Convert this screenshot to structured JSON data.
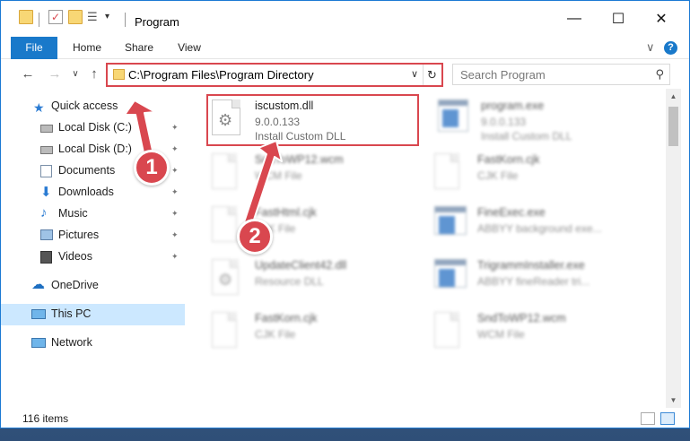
{
  "window": {
    "title": "Program",
    "minimize_label": "—",
    "maximize_label": "☐",
    "close_label": "✕",
    "accent_color": "#1979ca"
  },
  "ribbon": {
    "tabs": [
      "File",
      "Home",
      "Share",
      "View"
    ],
    "expand_glyph": "∨",
    "help_glyph": "?"
  },
  "navigation": {
    "back_glyph": "←",
    "forward_glyph": "→",
    "recent_glyph": "∨",
    "up_glyph": "↑",
    "address_path": "C:\\Program Files\\Program Directory",
    "address_dropdown_glyph": "∨",
    "refresh_glyph": "↻",
    "search_placeholder": "Search Program",
    "search_glyph": "⚲"
  },
  "sidebar": {
    "items": [
      {
        "label": "Quick access",
        "icon": "star-icon",
        "pinned": false
      },
      {
        "label": "Local Disk (C:)",
        "icon": "drive-icon",
        "pinned": true
      },
      {
        "label": "Local Disk (D:)",
        "icon": "drive-icon",
        "pinned": true
      },
      {
        "label": "Documents",
        "icon": "documents-icon",
        "pinned": true
      },
      {
        "label": "Downloads",
        "icon": "download-icon",
        "pinned": true
      },
      {
        "label": "Music",
        "icon": "music-icon",
        "pinned": true
      },
      {
        "label": "Pictures",
        "icon": "pictures-icon",
        "pinned": true
      },
      {
        "label": "Videos",
        "icon": "videos-icon",
        "pinned": true
      },
      {
        "label": "OneDrive",
        "icon": "cloud-icon",
        "pinned": false
      },
      {
        "label": "This PC",
        "icon": "computer-icon",
        "pinned": false,
        "selected": true
      },
      {
        "label": "Network",
        "icon": "network-icon",
        "pinned": false
      }
    ],
    "pin_glyph": "📌"
  },
  "files": [
    {
      "name": "iscustom.dll",
      "line1": "9.0.0.133",
      "line2": "Install Custom DLL",
      "icon": "dll-file-icon",
      "highlighted": true
    },
    {
      "name": "program.exe",
      "line1": "9.0.0.133",
      "line2": "Install Custom DLL",
      "icon": "exe-file-icon"
    },
    {
      "name": "SndToWP12.wcm",
      "line1": "WCM File",
      "line2": "",
      "icon": "document-file-icon"
    },
    {
      "name": "FastKorn.cjk",
      "line1": "CJK File",
      "line2": "",
      "icon": "document-file-icon"
    },
    {
      "name": "FastHtml.cjk",
      "line1": "CJK File",
      "line2": "",
      "icon": "document-file-icon"
    },
    {
      "name": "FineExec.exe",
      "line1": "ABBYY background exe...",
      "line2": "",
      "icon": "application-icon"
    },
    {
      "name": "UpdateClient42.dll",
      "line1": "Resource DLL",
      "line2": "",
      "icon": "dll-file-icon"
    },
    {
      "name": "TrigrammInstaller.exe",
      "line1": "ABBYY fineReader tri...",
      "line2": "",
      "icon": "application-icon"
    },
    {
      "name": "FastKorn.cjk",
      "line1": "CJK File",
      "line2": "",
      "icon": "document-file-icon"
    },
    {
      "name": "SndToWP12.wcm",
      "line1": "WCM File",
      "line2": "",
      "icon": "document-file-icon"
    }
  ],
  "status": {
    "item_count": "116 items"
  },
  "annotations": {
    "badge1": "1",
    "badge2": "2",
    "highlight_color": "#d9474f"
  }
}
